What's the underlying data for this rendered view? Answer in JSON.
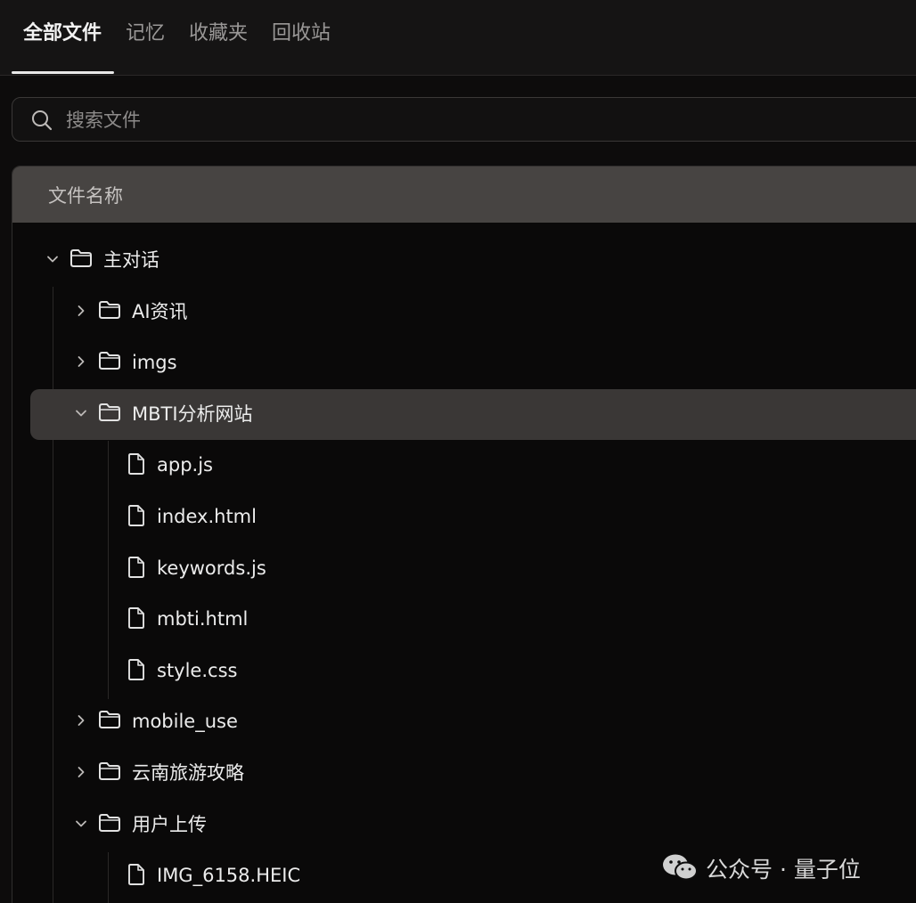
{
  "tabs": [
    {
      "label": "全部文件",
      "active": true
    },
    {
      "label": "记忆",
      "active": false
    },
    {
      "label": "收藏夹",
      "active": false
    },
    {
      "label": "回收站",
      "active": false
    }
  ],
  "search": {
    "placeholder": "搜索文件",
    "value": "",
    "icon": "search-icon"
  },
  "table": {
    "header": "文件名称"
  },
  "tree": [
    {
      "label": "主对话",
      "type": "folder",
      "expanded": true,
      "depth": 0
    },
    {
      "label": "AI资讯",
      "type": "folder",
      "expanded": false,
      "depth": 1
    },
    {
      "label": "imgs",
      "type": "folder",
      "expanded": false,
      "depth": 1
    },
    {
      "label": "MBTI分析网站",
      "type": "folder",
      "expanded": true,
      "depth": 1,
      "selected": true
    },
    {
      "label": "app.js",
      "type": "file",
      "depth": 2
    },
    {
      "label": "index.html",
      "type": "file",
      "depth": 2
    },
    {
      "label": "keywords.js",
      "type": "file",
      "depth": 2
    },
    {
      "label": "mbti.html",
      "type": "file",
      "depth": 2
    },
    {
      "label": "style.css",
      "type": "file",
      "depth": 2
    },
    {
      "label": "mobile_use",
      "type": "folder",
      "expanded": false,
      "depth": 1
    },
    {
      "label": "云南旅游攻略",
      "type": "folder",
      "expanded": false,
      "depth": 1
    },
    {
      "label": "用户上传",
      "type": "folder",
      "expanded": true,
      "depth": 1
    },
    {
      "label": "IMG_6158.HEIC",
      "type": "file",
      "depth": 2
    }
  ],
  "watermark": {
    "text": "公众号 · 量子位",
    "icon": "wechat-icon"
  },
  "colors": {
    "background": "#0d0c0c",
    "header": "#474442",
    "selected_row": "#3a3736",
    "text": "#ececec"
  }
}
